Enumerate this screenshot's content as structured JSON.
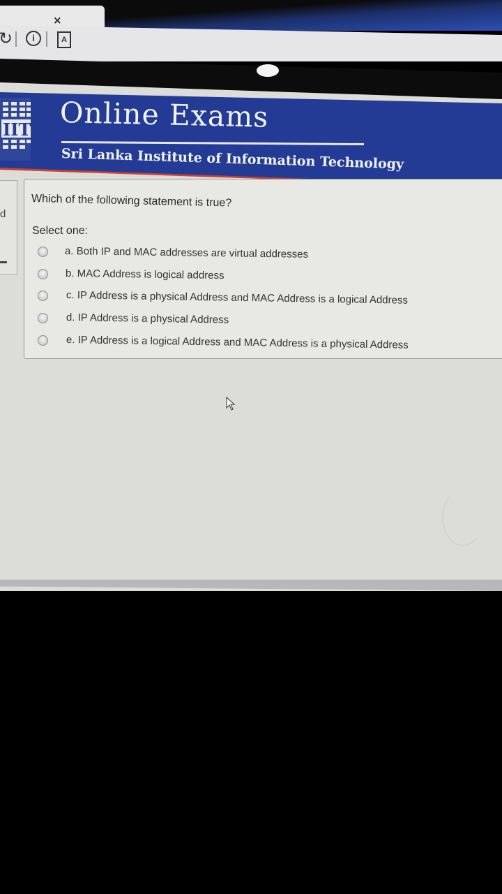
{
  "browser": {
    "tab_close": "×",
    "reload_icon": "reload-icon",
    "info_icon": "info-icon",
    "page_icon": "page-icon"
  },
  "header": {
    "title": "Online Exams",
    "subtitle": "Sri Lanka Institute of Information Technology",
    "logo_text": "IIT",
    "colors": {
      "banner": "#233b94",
      "stripe": "#c84232"
    }
  },
  "sidebar": {
    "fragment": "d"
  },
  "quiz": {
    "question": "Which of the following statement is true?",
    "prompt": "Select one:",
    "options": [
      {
        "label": "a. Both IP and MAC addresses are virtual addresses",
        "selected": false
      },
      {
        "label": "b. MAC Address is logical address",
        "selected": false
      },
      {
        "label": "c. IP Address is a physical Address and MAC Address is a logical Address",
        "selected": false
      },
      {
        "label": "d. IP Address is a physical Address",
        "selected": false
      },
      {
        "label": "e. IP Address is a logical Address and MAC Address is a physical Address",
        "selected": false
      }
    ]
  }
}
